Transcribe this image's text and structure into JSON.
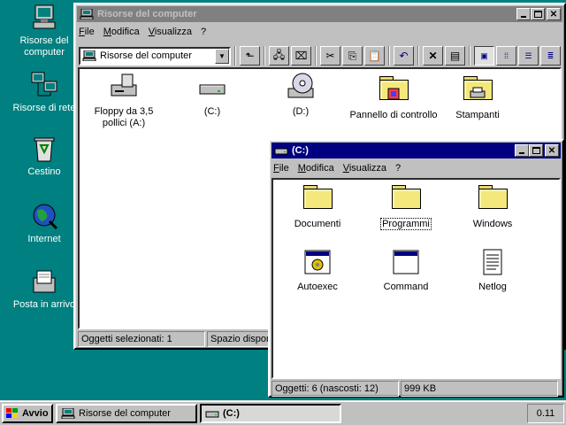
{
  "desktop": {
    "icons": [
      {
        "label": "Risorse del computer"
      },
      {
        "label": "Risorse di rete"
      },
      {
        "label": "Cestino"
      },
      {
        "label": "Internet"
      },
      {
        "label": "Posta in arrivo"
      }
    ]
  },
  "win_mycomputer": {
    "title": "Risorse del computer",
    "menu": [
      "File",
      "Modifica",
      "Visualizza",
      "?"
    ],
    "address": "Risorse del computer",
    "items": [
      {
        "label": "Floppy da 3,5 pollici (A:)"
      },
      {
        "label": "(C:)"
      },
      {
        "label": "(D:)"
      },
      {
        "label": "Pannello di controllo"
      },
      {
        "label": "Stampanti"
      }
    ],
    "status": {
      "selected": "Oggetti selezionati: 1",
      "space": "Spazio disponibile: 1,00 GB"
    }
  },
  "win_c": {
    "title": "(C:)",
    "menu": [
      "File",
      "Modifica",
      "Visualizza",
      "?"
    ],
    "items": [
      {
        "label": "Documenti",
        "type": "folder"
      },
      {
        "label": "Programmi",
        "type": "folder"
      },
      {
        "label": "Windows",
        "type": "folder"
      },
      {
        "label": "Autoexec",
        "type": "gear-app"
      },
      {
        "label": "Command",
        "type": "app"
      },
      {
        "label": "Netlog",
        "type": "text"
      }
    ],
    "status": {
      "objects": "Oggetti: 6 (nascosti: 12)",
      "size": "999 KB"
    }
  },
  "taskbar": {
    "start": "Avvio",
    "tasks": [
      {
        "label": "Risorse del computer"
      },
      {
        "label": "(C:)"
      }
    ],
    "clock": "0.11"
  },
  "colors": {
    "desktop": "#008080",
    "active_title": "#000080",
    "inactive_title": "#808080"
  }
}
